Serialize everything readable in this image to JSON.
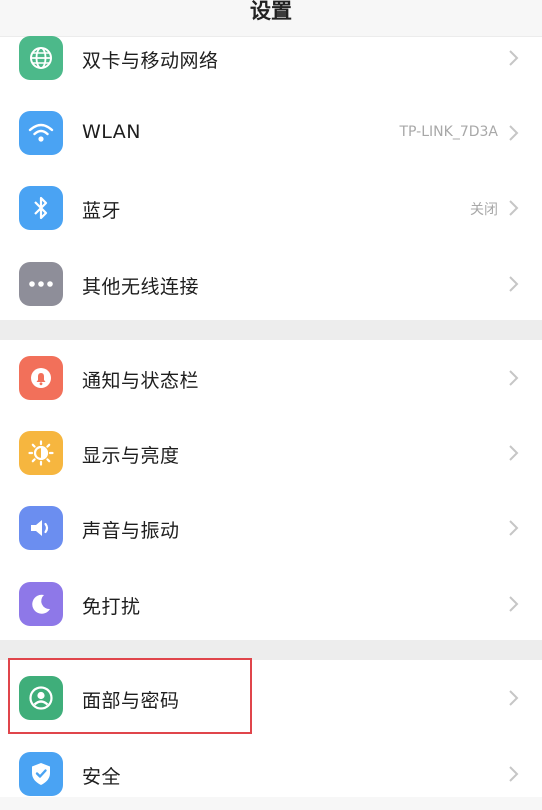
{
  "header": {
    "title": "设置"
  },
  "items": [
    {
      "id": "dual-sim",
      "label": "双卡与移动网络",
      "value": "",
      "icon": "globe-icon",
      "color": "#4cb98a"
    },
    {
      "id": "wlan",
      "label": "WLAN",
      "value": "TP-LINK_7D3A",
      "icon": "wifi-icon",
      "color": "#4aa3f3"
    },
    {
      "id": "bluetooth",
      "label": "蓝牙",
      "value": "关闭",
      "icon": "bluetooth-icon",
      "color": "#4aa3f3"
    },
    {
      "id": "other-wireless",
      "label": "其他无线连接",
      "value": "",
      "icon": "more-dots-icon",
      "color": "#8e8e99"
    },
    {
      "id": "notifications",
      "label": "通知与状态栏",
      "value": "",
      "icon": "bell-icon",
      "color": "#f2705a"
    },
    {
      "id": "display",
      "label": "显示与亮度",
      "value": "",
      "icon": "sun-icon",
      "color": "#f6b63f"
    },
    {
      "id": "sound",
      "label": "声音与振动",
      "value": "",
      "icon": "speaker-icon",
      "color": "#6b8ef0"
    },
    {
      "id": "dnd",
      "label": "免打扰",
      "value": "",
      "icon": "moon-icon",
      "color": "#8e78e8"
    },
    {
      "id": "face-password",
      "label": "面部与密码",
      "value": "",
      "icon": "face-icon",
      "color": "#3fae7a"
    },
    {
      "id": "security",
      "label": "安全",
      "value": "",
      "icon": "shield-icon",
      "color": "#4aa3f3"
    }
  ]
}
